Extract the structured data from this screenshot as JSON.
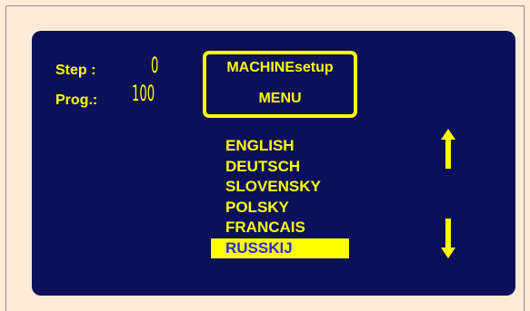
{
  "info": {
    "step_label": "Step :",
    "step_value": "0",
    "prog_label": "Prog.:",
    "prog_value": "100"
  },
  "title": {
    "line1": "MACHINEsetup",
    "line2": "MENU"
  },
  "languages": [
    {
      "label": "ENGLISH",
      "selected": false
    },
    {
      "label": "DEUTSCH",
      "selected": false
    },
    {
      "label": "SLOVENSKY",
      "selected": false
    },
    {
      "label": "POLSKY",
      "selected": false
    },
    {
      "label": "FRANCAIS",
      "selected": false
    },
    {
      "label": "RUSSKIJ",
      "selected": true
    }
  ],
  "icons": {
    "up": "arrow-up-icon",
    "down": "arrow-down-icon"
  },
  "colors": {
    "page_background": "#fdebd6",
    "screen_background": "#0b1158",
    "text": "#ffff00",
    "selected_background": "#ffff00",
    "selected_text": "#2b2bd6"
  }
}
